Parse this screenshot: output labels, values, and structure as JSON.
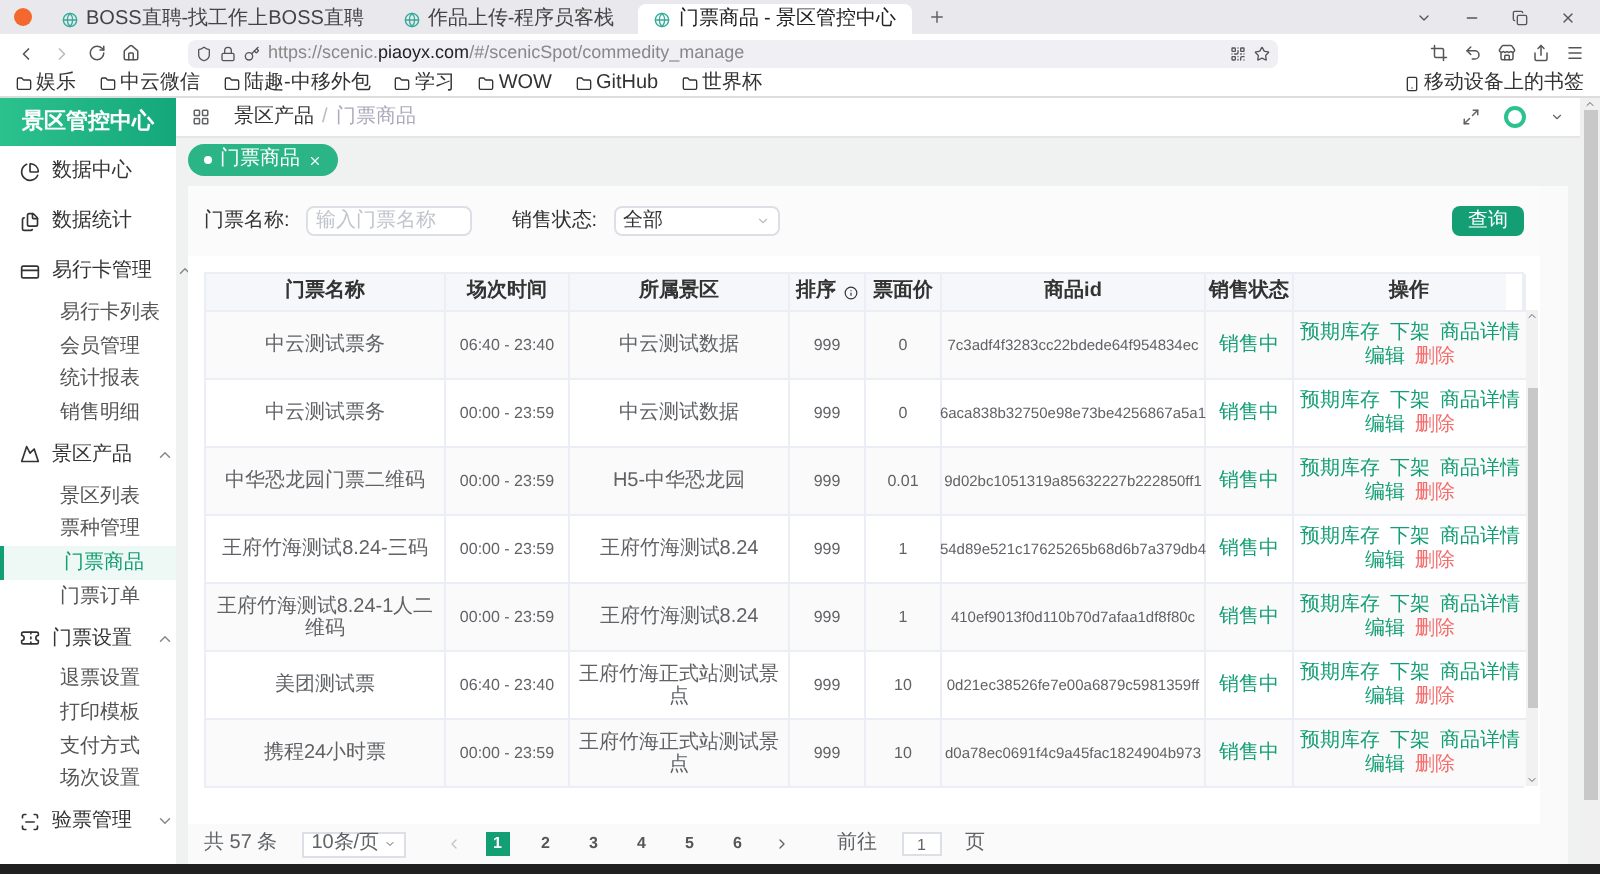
{
  "browser": {
    "tabs": [
      {
        "title": "BOSS直聘-找工作上BOSS直聘",
        "selected": false
      },
      {
        "title": "作品上传-程序员客栈",
        "selected": false
      },
      {
        "title": "门票商品 - 景区管控中心",
        "selected": true
      }
    ],
    "url": {
      "prefix": "https://scenic.",
      "domain": "piaoyx.com",
      "path": "/#/scenicSpot/commedity_manage"
    },
    "bookmarks": [
      "娱乐",
      "中云微信",
      "陆趣-中移外包",
      "学习",
      "WOW",
      "GitHub",
      "世界杯"
    ],
    "mobile_bookmarks": "移动设备上的书签"
  },
  "app": {
    "logo": "景区管控中心",
    "breadcrumb": {
      "items": [
        "景区产品",
        "门票商品"
      ],
      "separator": "/"
    },
    "sidebar": [
      {
        "label": "数据中心",
        "selected": false
      },
      {
        "label": "数据统计",
        "selected": false
      },
      {
        "label": "易行卡管理",
        "expanded": true,
        "children": [
          {
            "label": "易行卡列表",
            "selected": false
          },
          {
            "label": "会员管理",
            "selected": false
          },
          {
            "label": "统计报表",
            "selected": false
          },
          {
            "label": "销售明细",
            "selected": false
          }
        ]
      },
      {
        "label": "景区产品",
        "expanded": true,
        "children": [
          {
            "label": "景区列表",
            "selected": false
          },
          {
            "label": "票种管理",
            "selected": false
          },
          {
            "label": "门票商品",
            "selected": true
          },
          {
            "label": "门票订单",
            "selected": false
          }
        ]
      },
      {
        "label": "门票设置",
        "expanded": true,
        "children": [
          {
            "label": "退票设置",
            "selected": false
          },
          {
            "label": "打印模板",
            "selected": false
          },
          {
            "label": "支付方式",
            "selected": false
          },
          {
            "label": "场次设置",
            "selected": false
          }
        ]
      },
      {
        "label": "验票管理",
        "expanded": false
      }
    ],
    "open_tabs": [
      {
        "label": "门票商品",
        "selected": true
      }
    ],
    "filters": {
      "name_label": "门票名称:",
      "name_placeholder": "输入门票名称",
      "status_label": "销售状态:",
      "status_value": "全部",
      "search_button": "查询"
    },
    "table": {
      "columns": [
        "门票名称",
        "场次时间",
        "所属景区",
        "排序",
        "票面价",
        "商品id",
        "销售状态",
        "操作"
      ],
      "rows": [
        {
          "name": "中云测试票务",
          "time": "06:40 - 23:40",
          "area": "中云测试数据",
          "sort": "999",
          "price": "0",
          "id": "7c3adf4f3283cc22bdede64f954834ec",
          "status": "销售中",
          "actions": [
            {
              "label": "预期库存",
              "kind": "link"
            },
            {
              "label": "下架",
              "kind": "link"
            },
            {
              "label": "商品详情",
              "kind": "link"
            },
            {
              "label": "编辑",
              "kind": "link"
            },
            {
              "label": "删除",
              "kind": "danger"
            }
          ]
        },
        {
          "name": "中云测试票务",
          "time": "00:00 - 23:59",
          "area": "中云测试数据",
          "sort": "999",
          "price": "0",
          "id": "6aca838b32750e98e73be4256867a5a1",
          "status": "销售中",
          "actions": [
            {
              "label": "预期库存",
              "kind": "link"
            },
            {
              "label": "下架",
              "kind": "link"
            },
            {
              "label": "商品详情",
              "kind": "link"
            },
            {
              "label": "编辑",
              "kind": "link"
            },
            {
              "label": "删除",
              "kind": "danger"
            }
          ]
        },
        {
          "name": "中华恐龙园门票二维码",
          "time": "00:00 - 23:59",
          "area": "H5-中华恐龙园",
          "sort": "999",
          "price": "0.01",
          "id": "9d02bc1051319a85632227b222850ff1",
          "status": "销售中",
          "actions": [
            {
              "label": "预期库存",
              "kind": "link"
            },
            {
              "label": "下架",
              "kind": "link"
            },
            {
              "label": "商品详情",
              "kind": "link"
            },
            {
              "label": "编辑",
              "kind": "link"
            },
            {
              "label": "删除",
              "kind": "danger"
            }
          ]
        },
        {
          "name": "王府竹海测试8.24-三码",
          "time": "00:00 - 23:59",
          "area": "王府竹海测试8.24",
          "sort": "999",
          "price": "1",
          "id": "54d89e521c17625265b68d6b7a379db4",
          "status": "销售中",
          "actions": [
            {
              "label": "预期库存",
              "kind": "link"
            },
            {
              "label": "下架",
              "kind": "link"
            },
            {
              "label": "商品详情",
              "kind": "link"
            },
            {
              "label": "编辑",
              "kind": "link"
            },
            {
              "label": "删除",
              "kind": "danger"
            }
          ]
        },
        {
          "name": "王府竹海测试8.24-1人二维码",
          "time": "00:00 - 23:59",
          "area": "王府竹海测试8.24",
          "sort": "999",
          "price": "1",
          "id": "410ef9013f0d110b70d7afaa1df8f80c",
          "status": "销售中",
          "actions": [
            {
              "label": "预期库存",
              "kind": "link"
            },
            {
              "label": "下架",
              "kind": "link"
            },
            {
              "label": "商品详情",
              "kind": "link"
            },
            {
              "label": "编辑",
              "kind": "link"
            },
            {
              "label": "删除",
              "kind": "danger"
            }
          ]
        },
        {
          "name": "美团测试票",
          "time": "06:40 - 23:40",
          "area": "王府竹海正式站测试景点",
          "sort": "999",
          "price": "10",
          "id": "0d21ec38526fe7e00a6879c5981359ff",
          "status": "销售中",
          "actions": [
            {
              "label": "预期库存",
              "kind": "link"
            },
            {
              "label": "下架",
              "kind": "link"
            },
            {
              "label": "商品详情",
              "kind": "link"
            },
            {
              "label": "编辑",
              "kind": "link"
            },
            {
              "label": "删除",
              "kind": "danger"
            }
          ]
        },
        {
          "name": "携程24小时票",
          "time": "00:00 - 23:59",
          "area": "王府竹海正式站测试景点",
          "sort": "999",
          "price": "10",
          "id": "d0a78ec0691f4c9a45fac1824904b973",
          "status": "销售中",
          "actions": [
            {
              "label": "预期库存",
              "kind": "link"
            },
            {
              "label": "下架",
              "kind": "link"
            },
            {
              "label": "商品详情",
              "kind": "link"
            },
            {
              "label": "编辑",
              "kind": "link"
            },
            {
              "label": "删除",
              "kind": "danger"
            }
          ]
        }
      ]
    },
    "pagination": {
      "total": "共 57 条",
      "page_size": "10条/页",
      "pages": [
        {
          "label": "1",
          "selected": true
        },
        {
          "label": "2",
          "selected": false
        },
        {
          "label": "3",
          "selected": false
        },
        {
          "label": "4",
          "selected": false
        },
        {
          "label": "5",
          "selected": false
        },
        {
          "label": "6",
          "selected": false
        }
      ],
      "goto_label": "前往",
      "goto_value": "1",
      "goto_suffix": "页"
    }
  }
}
